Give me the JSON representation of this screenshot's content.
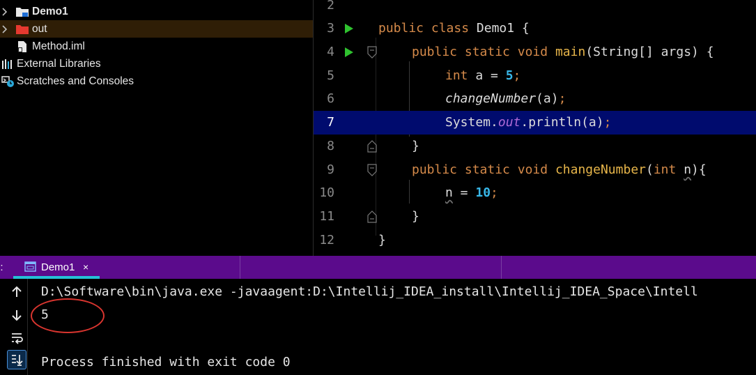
{
  "project_tree": [
    {
      "label": "Demo1",
      "icon": "folder-module-icon",
      "expandable": true,
      "bold": true
    },
    {
      "label": "out",
      "icon": "folder-excluded-icon",
      "expandable": true,
      "selected": true
    },
    {
      "label": "Method.iml",
      "icon": "iml-file-icon"
    },
    {
      "label": "External Libraries",
      "icon": "libraries-icon"
    },
    {
      "label": "Scratches and Consoles",
      "icon": "scratches-icon"
    }
  ],
  "editor": {
    "line_numbers": [
      "2",
      "3",
      "4",
      "5",
      "6",
      "7",
      "8",
      "9",
      "10",
      "11",
      "12"
    ],
    "current_line": "7",
    "code": {
      "l3": {
        "kw1": "public",
        "kw2": "class",
        "name": "Demo1",
        "brace": " {"
      },
      "l4": {
        "kw1": "public",
        "kw2": "static",
        "kw3": "void",
        "fn": "main",
        "params": "(String[] args) {"
      },
      "l5": {
        "kw": "int",
        "rest": " a = ",
        "num": "5",
        "end": ";"
      },
      "l6": {
        "call": "changeNumber",
        "args": "(a)",
        "end": ";"
      },
      "l7": {
        "cls": "System.",
        "field": "out",
        "method": ".println(a)",
        "end": ";"
      },
      "l8": {
        "text": "}"
      },
      "l9": {
        "kw1": "public",
        "kw2": "static",
        "kw3": "void",
        "fn": "changeNumber",
        "open": "(",
        "ptype": "int",
        "pname": "n",
        "close": "){"
      },
      "l10": {
        "var": "n",
        "mid": " = ",
        "num": "10",
        "end": ";"
      },
      "l11": {
        "text": "}"
      },
      "l12": {
        "text": "}"
      }
    }
  },
  "run_window": {
    "label": "n:",
    "tab": {
      "label": "Demo1",
      "close": "×"
    }
  },
  "console": {
    "lines": [
      "D:\\Software\\bin\\java.exe -javaagent:D:\\Intellij_IDEA_install\\Intellij_IDEA_Space\\Intell",
      "5",
      "",
      "Process finished with exit code 0"
    ]
  },
  "colors": {
    "keyword": "#d58a4a",
    "function": "#e8b64a",
    "number": "#38b7e8",
    "field": "#b06ad6",
    "current_line_bg": "#000b6e",
    "run_header_bg": "#5b0b8c",
    "tab_underline": "#25c0d6",
    "annotation_circle": "#d9352f"
  }
}
